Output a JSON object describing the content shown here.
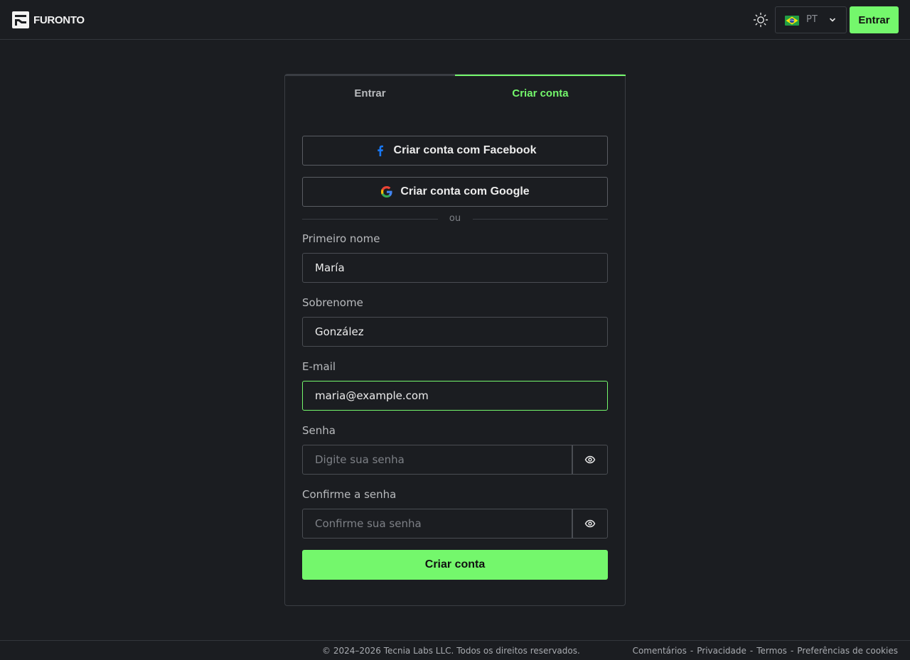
{
  "header": {
    "brand": "FURONTO",
    "language_code": "PT",
    "login_label": "Entrar"
  },
  "tabs": {
    "login": "Entrar",
    "signup": "Criar conta"
  },
  "social": {
    "facebook": "Criar conta com Facebook",
    "google": "Criar conta com Google"
  },
  "divider": "ou",
  "form": {
    "first_name_label": "Primeiro nome",
    "first_name_value": "María",
    "last_name_label": "Sobrenome",
    "last_name_value": "González",
    "email_label": "E-mail",
    "email_value": "maria@example.com",
    "password_label": "Senha",
    "password_placeholder": "Digite sua senha",
    "confirm_label": "Confirme a senha",
    "confirm_placeholder": "Confirme sua senha",
    "submit_label": "Criar conta"
  },
  "footer": {
    "copyright": "© 2024–2026 Tecnia Labs LLC. Todos os direitos reservados.",
    "links": [
      "Comentários",
      "Privacidade",
      "Termos",
      "Preferências de cookies"
    ],
    "separator": "-"
  },
  "colors": {
    "accent": "#74f76c",
    "background": "#1b1d21",
    "border": "#3a3d43"
  },
  "icons": [
    "logo-icon",
    "sun-icon",
    "brazil-flag-icon",
    "chevron-down-icon",
    "facebook-icon",
    "google-icon",
    "eye-icon"
  ]
}
